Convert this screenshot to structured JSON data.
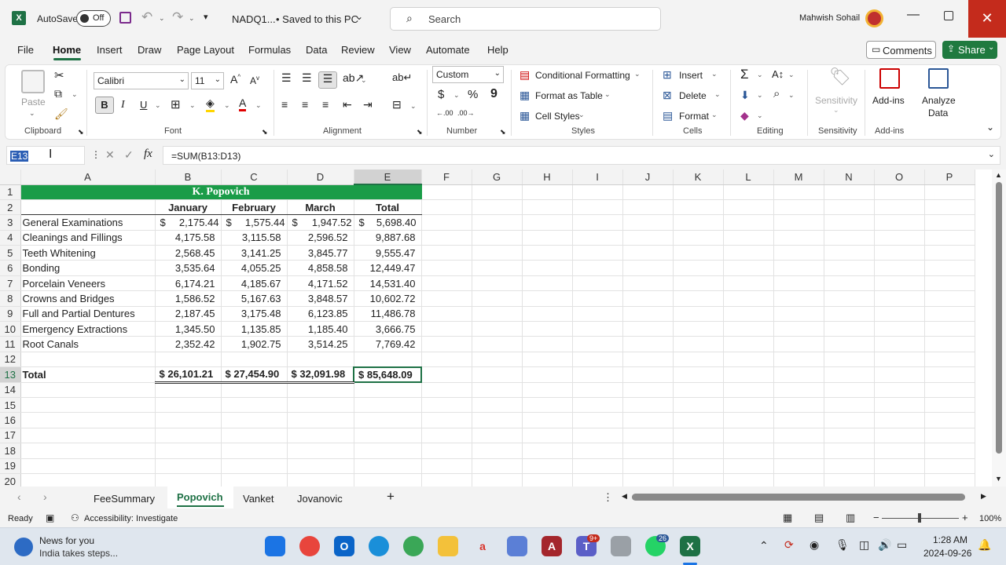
{
  "titlebar": {
    "autosave_label": "AutoSave",
    "autosave_state": "Off",
    "filename": "NADQ1...",
    "save_status": "• Saved to this PC",
    "search_placeholder": "Search",
    "user_name": "Mahwish Sohail"
  },
  "menu": {
    "tabs": [
      "File",
      "Home",
      "Insert",
      "Draw",
      "Page Layout",
      "Formulas",
      "Data",
      "Review",
      "View",
      "Automate",
      "Help"
    ],
    "comments_label": "Comments",
    "share_label": "Share"
  },
  "ribbon": {
    "clipboard": {
      "paste": "Paste",
      "label": "Clipboard"
    },
    "font": {
      "name": "Calibri",
      "size": "11",
      "label": "Font"
    },
    "alignment": {
      "label": "Alignment"
    },
    "number": {
      "format": "Custom",
      "label": "Number"
    },
    "styles": {
      "conditional": "Conditional Formatting",
      "format_table": "Format as Table",
      "cell_styles": "Cell Styles",
      "label": "Styles"
    },
    "cells": {
      "insert": "Insert",
      "delete": "Delete",
      "format": "Format",
      "label": "Cells"
    },
    "editing": {
      "label": "Editing"
    },
    "sensitivity": {
      "button": "Sensitivity",
      "label": "Sensitivity"
    },
    "addins": {
      "button": "Add-ins",
      "label": "Add-ins"
    },
    "analyze": {
      "line1": "Analyze",
      "line2": "Data"
    }
  },
  "formula_bar": {
    "name_box": "E13",
    "formula": "=SUM(B13:D13)"
  },
  "sheet": {
    "columns": [
      "A",
      "B",
      "C",
      "D",
      "E",
      "F",
      "G",
      "H",
      "I",
      "J",
      "K",
      "L",
      "M",
      "N",
      "O",
      "P"
    ],
    "title": "K. Popovich",
    "headers": [
      "January",
      "February",
      "March",
      "Total"
    ],
    "rows": [
      {
        "label": "General Examinations",
        "b": "2,175.44",
        "c": "1,575.44",
        "d": "1,947.52",
        "e": "5,698.40"
      },
      {
        "label": "Cleanings and Fillings",
        "b": "4,175.58",
        "c": "3,115.58",
        "d": "2,596.52",
        "e": "9,887.68"
      },
      {
        "label": "Teeth Whitening",
        "b": "2,568.45",
        "c": "3,141.25",
        "d": "3,845.77",
        "e": "9,555.47"
      },
      {
        "label": "Bonding",
        "b": "3,535.64",
        "c": "4,055.25",
        "d": "4,858.58",
        "e": "12,449.47"
      },
      {
        "label": "Porcelain Veneers",
        "b": "6,174.21",
        "c": "4,185.67",
        "d": "4,171.52",
        "e": "14,531.40"
      },
      {
        "label": "Crowns and Bridges",
        "b": "1,586.52",
        "c": "5,167.63",
        "d": "3,848.57",
        "e": "10,602.72"
      },
      {
        "label": "Full and Partial Dentures",
        "b": "2,187.45",
        "c": "3,175.48",
        "d": "6,123.85",
        "e": "11,486.78"
      },
      {
        "label": "Emergency Extractions",
        "b": "1,345.50",
        "c": "1,135.85",
        "d": "1,185.40",
        "e": "3,666.75"
      },
      {
        "label": "Root Canals",
        "b": "2,352.42",
        "c": "1,902.75",
        "d": "3,514.25",
        "e": "7,769.42"
      }
    ],
    "total": {
      "label": "Total",
      "b": "$ 26,101.21",
      "c": "$ 27,454.90",
      "d": "$ 32,091.98",
      "e": "$ 85,648.09"
    },
    "currency": "$",
    "row_numbers": [
      "1",
      "2",
      "3",
      "4",
      "5",
      "6",
      "7",
      "8",
      "9",
      "10",
      "11",
      "12",
      "13",
      "14",
      "15",
      "16",
      "17",
      "18",
      "19",
      "20"
    ]
  },
  "sheet_tabs": [
    "FeeSummary",
    "Popovich",
    "Vanket",
    "Jovanovic"
  ],
  "active_sheet": "Popovich",
  "status": {
    "ready": "Ready",
    "accessibility": "Accessibility: Investigate",
    "zoom": "100%"
  },
  "taskbar": {
    "news_title": "News for you",
    "news_sub": "India takes steps...",
    "time": "1:28 AM",
    "date": "2024-09-26",
    "teams_badge": "9+",
    "whatsapp_badge": "26"
  },
  "colors": {
    "excel_green": "#1e7145",
    "title_fill": "#1a9c48",
    "share": "#1f7a3f",
    "close": "#c42b1c"
  }
}
